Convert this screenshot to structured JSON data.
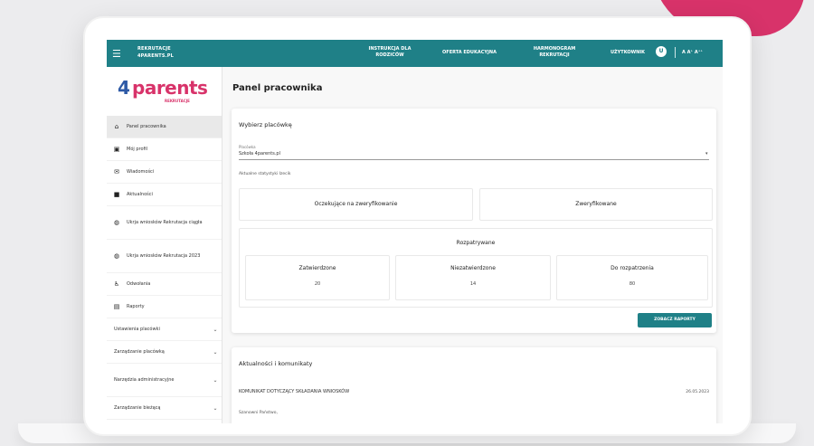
{
  "topbar": {
    "menu_icon": "menu-icon",
    "brand_line1": "REKRUTACJE",
    "brand_line2": "4PARENTS.PL",
    "nav": [
      {
        "line1": "INSTRUKCJA DLA",
        "line2": "RODZICÓW"
      },
      {
        "line1": "OFERTA EDUKACYJNA",
        "line2": ""
      },
      {
        "line1": "HARMONOGRAM",
        "line2": "REKRUTACJI"
      }
    ],
    "user_label": "UŻYTKOWNIK",
    "user_initials": "U",
    "font_size_control": "A A⁺ A⁺⁺",
    "accent_color": "#1f8087"
  },
  "logo": {
    "word": "parents",
    "prefix": "4",
    "subtitle": "REKRUTACJE",
    "brand_color": "#d8336a"
  },
  "sidebar": {
    "items": [
      {
        "label": "Panel pracownika",
        "icon": "home-icon"
      },
      {
        "label": "Mój profil",
        "icon": "profile-card-icon"
      },
      {
        "label": "Wiadomości",
        "icon": "messages-icon"
      },
      {
        "label": "Aktualności",
        "icon": "news-icon"
      },
      {
        "label": "Ukrja wniosków Rekrutacja ciągła",
        "icon": "globe-icon"
      },
      {
        "label": "Ukrja wniosków Rekrutacja 2023",
        "icon": "globe-icon"
      },
      {
        "label": "Odwołania",
        "icon": "person-walk-icon"
      },
      {
        "label": "Raporty",
        "icon": "report-icon"
      }
    ],
    "groups": [
      {
        "label": "Ustawienia placówki"
      },
      {
        "label": "Zarządzanie placówką"
      },
      {
        "label": "Narzędzia administracyjne"
      },
      {
        "label": "Zarządzanie bieżącą"
      }
    ]
  },
  "main": {
    "page_title": "Panel pracownika",
    "select_title": "Wybierz placówkę",
    "field_label": "Placówka",
    "field_value": "Szkoła 4parents.pl",
    "stats_label": "Aktualne statystyki Izecik",
    "box_pending": "Oczekujące na zweryfikowanie",
    "box_verified": "Zweryfikowane",
    "group_title": "Rozpatrywane",
    "sub_boxes": [
      {
        "title": "Zatwierdzone",
        "value": "20"
      },
      {
        "title": "Niezatwierdzone",
        "value": "14"
      },
      {
        "title": "Do rozpatrzenia",
        "value": "80"
      }
    ],
    "reports_button": "ZOBACZ RAPORTY"
  },
  "news": {
    "title": "Aktualności i komunikaty",
    "item": "KOMUNIKAT DOTYCZĄCY SKŁADANIA WNIOSKÓW",
    "date": "26.05.2023",
    "body": "Szanowni Państwo,"
  }
}
